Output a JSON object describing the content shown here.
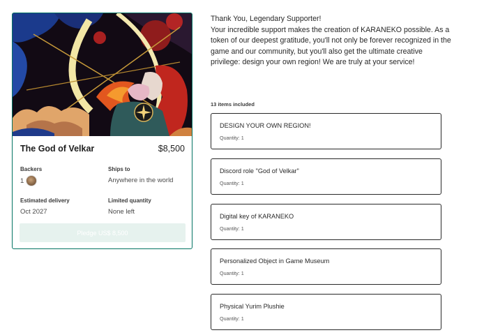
{
  "reward": {
    "title": "The God of Velkar",
    "price": "$8,500",
    "backers_label": "Backers",
    "backers_value": "1",
    "ships_to_label": "Ships to",
    "ships_to_value": "Anywhere in the world",
    "delivery_label": "Estimated delivery",
    "delivery_value": "Oct 2027",
    "quantity_label": "Limited quantity",
    "quantity_value": "None left",
    "pledge_button": "Pledge US$ 8,500",
    "border_color": "#037362",
    "button_bg": "#e6f2ee"
  },
  "description": {
    "line1": "Thank You, Legendary Supporter!",
    "line2": "Your incredible support makes the creation of KARANEKO possible. As a token of our deepest gratitude, you'll not only be forever recognized in the game and our community, but you'll also get the ultimate creative privilege: design your own region! We are truly at your service!"
  },
  "items_count": "13 items included",
  "items": [
    {
      "name": "DESIGN YOUR OWN REGION!",
      "quantity": "Quantity: 1"
    },
    {
      "name": "Discord role \"God of Velkar\"",
      "quantity": "Quantity: 1"
    },
    {
      "name": "Digital key of KARANEKO",
      "quantity": "Quantity: 1"
    },
    {
      "name": "Personalized Object in Game Museum",
      "quantity": "Quantity: 1"
    },
    {
      "name": "Physical Yurim Plushie",
      "quantity": "Quantity: 1"
    }
  ]
}
